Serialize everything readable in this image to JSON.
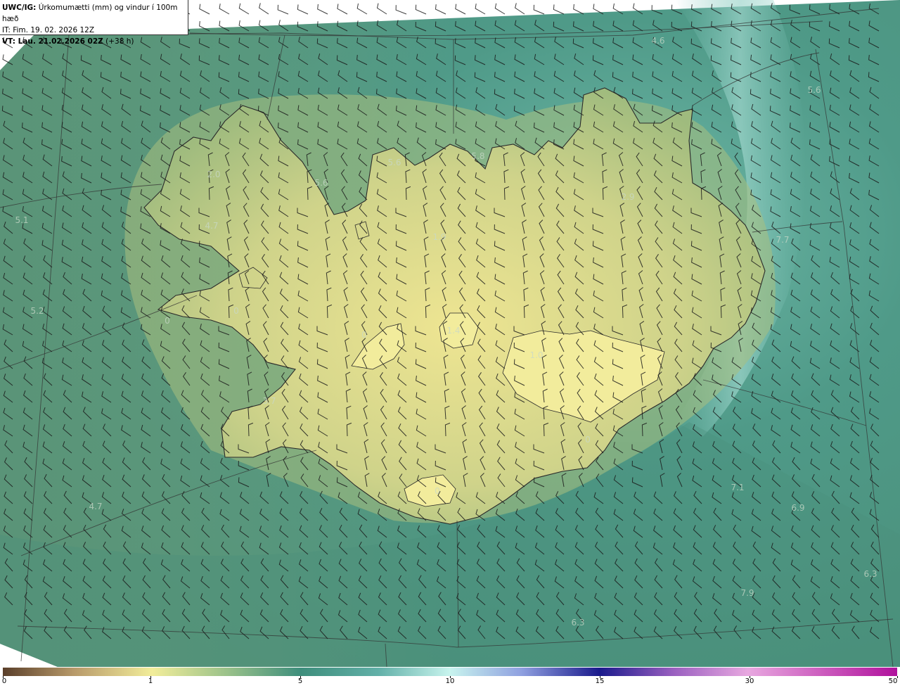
{
  "header": {
    "model": "UWC/IG:",
    "title": "Úrkomumætti (mm) og vindur í 100m hæð",
    "issue_time": "IT: Fim. 19. 02. 2026 12Z",
    "valid_prefix": "VT: Lau. 21.02.2026 02Z",
    "lead_time": "(+38 h)"
  },
  "colors": {
    "low": "#5a3f2a",
    "light": "#f2ed9a",
    "mid": "#3e8e7c",
    "high_teal": "#c8f4ee",
    "deep": "#1a1a8c",
    "magenta": "#b0119c"
  },
  "colorbar": {
    "ticks": [
      "0",
      "1",
      "5",
      "10",
      "15",
      "30",
      "50"
    ]
  },
  "value_labels": [
    {
      "text": "4.6",
      "pos": [
        936,
        58
      ]
    },
    {
      "text": "5.6",
      "pos": [
        1158,
        128
      ]
    },
    {
      "text": "5.8",
      "pos": [
        680,
        222
      ]
    },
    {
      "text": "5.6",
      "pos": [
        561,
        231
      ]
    },
    {
      "text": "5.6",
      "pos": [
        457,
        260
      ]
    },
    {
      "text": "2.0",
      "pos": [
        304,
        248
      ]
    },
    {
      "text": "2.9",
      "pos": [
        893,
        280
      ]
    },
    {
      "text": "5.1",
      "pos": [
        31,
        313
      ]
    },
    {
      "text": "4.7",
      "pos": [
        301,
        321
      ]
    },
    {
      "text": "1.9",
      "pos": [
        625,
        337
      ]
    },
    {
      "text": "7.7",
      "pos": [
        1113,
        341
      ]
    },
    {
      "text": "5.2",
      "pos": [
        53,
        442
      ]
    },
    {
      "text": "0",
      "pos": [
        238,
        456
      ]
    },
    {
      "text": "0",
      "pos": [
        336,
        442
      ]
    },
    {
      "text": "1.4",
      "pos": [
        645,
        470
      ]
    },
    {
      "text": "0",
      "pos": [
        518,
        476
      ]
    },
    {
      "text": "1.0",
      "pos": [
        763,
        505
      ]
    },
    {
      "text": "3.7",
      "pos": [
        383,
        570
      ]
    },
    {
      "text": "0",
      "pos": [
        836,
        625
      ]
    },
    {
      "text": "0",
      "pos": [
        622,
        698
      ]
    },
    {
      "text": "7.1",
      "pos": [
        1049,
        693
      ]
    },
    {
      "text": "4.7",
      "pos": [
        136,
        720
      ]
    },
    {
      "text": "6.9",
      "pos": [
        1135,
        722
      ]
    },
    {
      "text": "6.3",
      "pos": [
        1238,
        816
      ]
    },
    {
      "text": "7.9",
      "pos": [
        1063,
        843
      ]
    },
    {
      "text": "6.3",
      "pos": [
        822,
        885
      ]
    }
  ]
}
